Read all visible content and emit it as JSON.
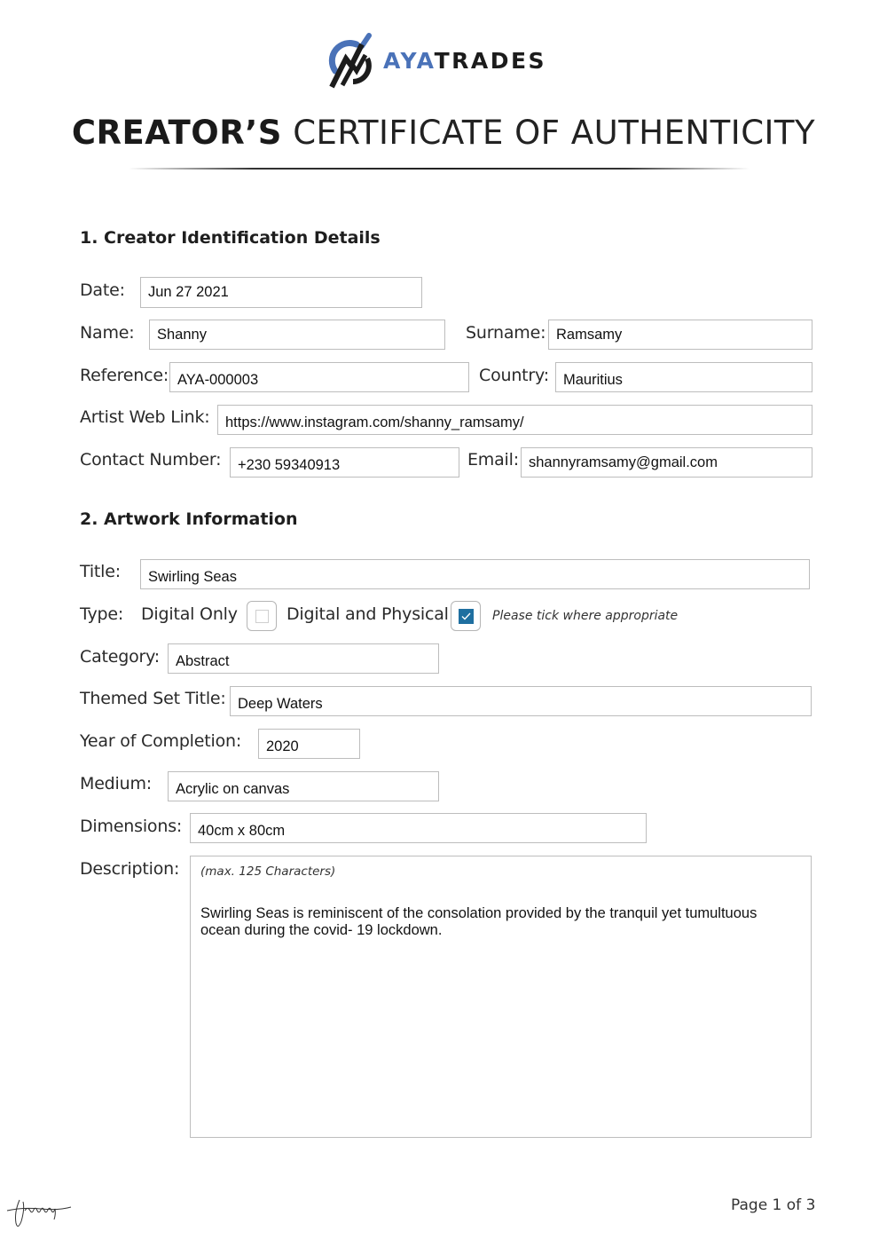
{
  "brand": {
    "name_part1": "AYA",
    "name_part2": "TRADES",
    "accent_color": "#4a72b8"
  },
  "header": {
    "title_bold": "CREATOR’S",
    "title_light": "CERTIFICATE OF AUTHENTICITY"
  },
  "section1": {
    "heading": "1. Creator Identification Details",
    "date_label": "Date:",
    "date_value": "Jun 27 2021",
    "name_label": "Name:",
    "name_value": "Shanny",
    "surname_label": "Surname:",
    "surname_value": "Ramsamy",
    "reference_label": "Reference:",
    "reference_value": "AYA-000003",
    "country_label": "Country:",
    "country_value": "Mauritius",
    "weblink_label": "Artist Web Link:",
    "weblink_value": "https://www.instagram.com/shanny_ramsamy/",
    "contact_label": "Contact Number:",
    "contact_value": "+230 59340913",
    "email_label": "Email:",
    "email_value": "shannyramsamy@gmail.com"
  },
  "section2": {
    "heading": "2. Artwork Information",
    "title_label": "Title:",
    "title_value": "Swirling Seas",
    "type_label": "Type:",
    "type_options": [
      {
        "label": "Digital Only",
        "checked": false
      },
      {
        "label": "Digital and Physical",
        "checked": true
      }
    ],
    "type_hint": "Please tick where appropriate",
    "checkbox_color": "#1f6fa0",
    "category_label": "Category:",
    "category_value": "Abstract",
    "themed_set_label": "Themed Set Title:",
    "themed_set_value": "Deep Waters",
    "year_label": "Year of Completion:",
    "year_value": "2020",
    "medium_label": "Medium:",
    "medium_value": "Acrylic on canvas",
    "dimensions_label": "Dimensions:",
    "dimensions_value": "40cm x 80cm",
    "description_label": "Description:",
    "description_hint": "(max. 125 Characters)",
    "description_value": "Swirling Seas is reminiscent of the consolation provided by the tranquil yet tumultuous ocean during the covid- 19 lockdown."
  },
  "footer": {
    "signature_text": "Ramsamy",
    "page_label": "Page 1 of 3"
  }
}
